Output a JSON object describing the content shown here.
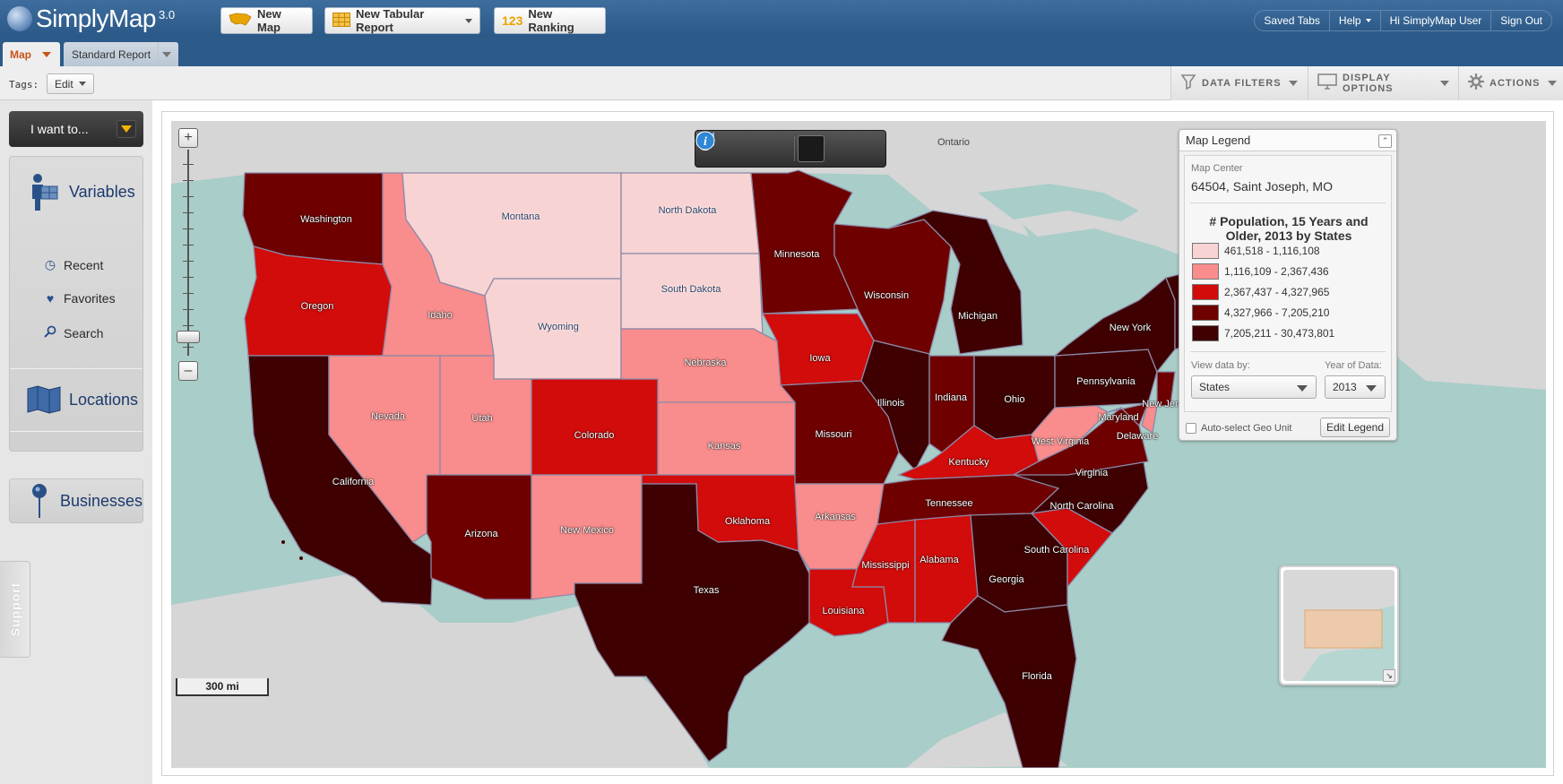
{
  "app": {
    "name": "SimplyMap",
    "version": "3.0"
  },
  "header": {
    "new_map": "New Map",
    "new_tabular_report": "New Tabular Report",
    "new_ranking": "New Ranking",
    "new_ranking_icon_text": "123",
    "saved_tabs": "Saved Tabs",
    "help": "Help",
    "user": "Hi SimplyMap User",
    "sign_out": "Sign Out"
  },
  "tabs": [
    {
      "label": "Map",
      "active": true
    },
    {
      "label": "Standard Report",
      "active": false
    }
  ],
  "toolbar": {
    "tags_label": "Tags:",
    "edit_label": "Edit",
    "data_filters": "DATA FILTERS",
    "display_options": "DISPLAY OPTIONS",
    "actions": "ACTIONS"
  },
  "sidebar": {
    "i_want_to": "I want to...",
    "variables": "Variables",
    "recent": "Recent",
    "favorites": "Favorites",
    "search": "Search",
    "locations": "Locations",
    "businesses": "Businesses",
    "support": "Support"
  },
  "map": {
    "other_label": "Ontario",
    "scale_bar": "300 mi",
    "colors": {
      "c1": "#f8d3d3",
      "c2": "#f98c8c",
      "c3": "#d20b0b",
      "c4": "#6e0000",
      "c5": "#3e0000",
      "land": "#d6d6d6",
      "water": "#a9cdc8"
    },
    "states": [
      {
        "name": "Washington",
        "cls": 4
      },
      {
        "name": "Oregon",
        "cls": 3
      },
      {
        "name": "California",
        "cls": 5
      },
      {
        "name": "Idaho",
        "cls": 2
      },
      {
        "name": "Nevada",
        "cls": 2
      },
      {
        "name": "Montana",
        "cls": 1
      },
      {
        "name": "Wyoming",
        "cls": 1
      },
      {
        "name": "Utah",
        "cls": 2
      },
      {
        "name": "Arizona",
        "cls": 4
      },
      {
        "name": "Colorado",
        "cls": 3
      },
      {
        "name": "New Mexico",
        "cls": 2
      },
      {
        "name": "North Dakota",
        "cls": 1
      },
      {
        "name": "South Dakota",
        "cls": 1
      },
      {
        "name": "Nebraska",
        "cls": 2
      },
      {
        "name": "Kansas",
        "cls": 2
      },
      {
        "name": "Oklahoma",
        "cls": 3
      },
      {
        "name": "Texas",
        "cls": 5
      },
      {
        "name": "Minnesota",
        "cls": 4
      },
      {
        "name": "Iowa",
        "cls": 3
      },
      {
        "name": "Missouri",
        "cls": 4
      },
      {
        "name": "Arkansas",
        "cls": 2
      },
      {
        "name": "Louisiana",
        "cls": 3
      },
      {
        "name": "Wisconsin",
        "cls": 4
      },
      {
        "name": "Illinois",
        "cls": 5
      },
      {
        "name": "Michigan",
        "cls": 5
      },
      {
        "name": "Indiana",
        "cls": 4
      },
      {
        "name": "Ohio",
        "cls": 5
      },
      {
        "name": "Kentucky",
        "cls": 3
      },
      {
        "name": "Tennessee",
        "cls": 4
      },
      {
        "name": "Mississippi",
        "cls": 3
      },
      {
        "name": "Alabama",
        "cls": 3
      },
      {
        "name": "Georgia",
        "cls": 5
      },
      {
        "name": "Florida",
        "cls": 5
      },
      {
        "name": "South Carolina",
        "cls": 3
      },
      {
        "name": "North Carolina",
        "cls": 5
      },
      {
        "name": "Virginia",
        "cls": 4
      },
      {
        "name": "West Virginia",
        "cls": 2
      },
      {
        "name": "Pennsylvania",
        "cls": 5
      },
      {
        "name": "New York",
        "cls": 5
      },
      {
        "name": "Maryland",
        "cls": 4
      },
      {
        "name": "Delaware",
        "cls": 2
      },
      {
        "name": "New Jersey",
        "cls": 4
      }
    ]
  },
  "legend": {
    "title": "Map Legend",
    "map_center_label": "Map Center",
    "map_center_value": "64504, Saint Joseph, MO",
    "variable_title": "# Population, 15 Years and Older, 2013 by States",
    "ranges": [
      {
        "label": "461,518 - 1,116,108",
        "color": "#f8d3d3"
      },
      {
        "label": "1,116,109 - 2,367,436",
        "color": "#f98c8c"
      },
      {
        "label": "2,367,437 - 4,327,965",
        "color": "#d20b0b"
      },
      {
        "label": "4,327,966 - 7,205,210",
        "color": "#6e0000"
      },
      {
        "label": "7,205,211 - 30,473,801",
        "color": "#3e0000"
      }
    ],
    "view_data_by_label": "View data by:",
    "view_data_by_value": "States",
    "year_label": "Year of Data:",
    "year_value": "2013",
    "auto_select": "Auto-select Geo Unit",
    "edit_legend": "Edit Legend"
  }
}
